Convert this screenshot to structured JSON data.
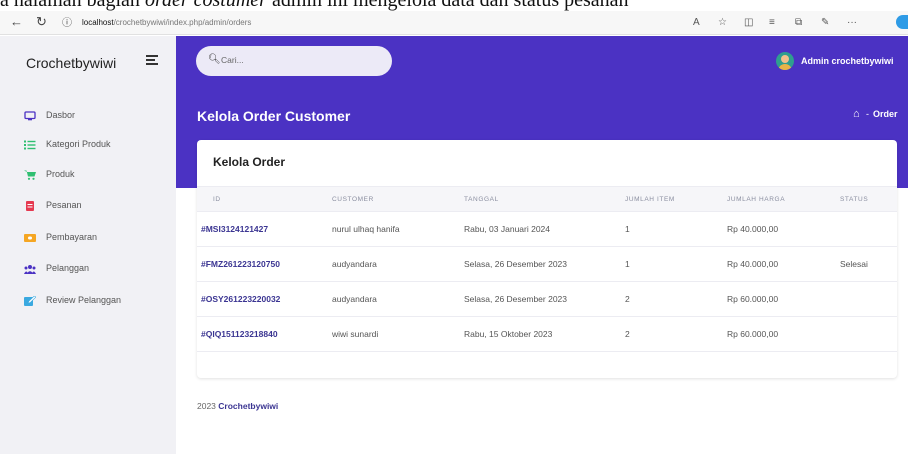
{
  "caption": {
    "prefix": "a halaman bagian ",
    "italic": "order costumer",
    "suffix": " admin ini mengelola data dan status pesanan"
  },
  "browser": {
    "url_host": "localhost",
    "url_path": "/crochetbywiwi/index.php/admin/orders"
  },
  "sidebar": {
    "brand": "Crochetbywiwi",
    "items": [
      {
        "label": "Dasbor",
        "icon": "monitor-icon",
        "color": "#4b32c3"
      },
      {
        "label": "Kategori Produk",
        "icon": "list-icon",
        "color": "#2fbf71"
      },
      {
        "label": "Produk",
        "icon": "cart-icon",
        "color": "#2fbf71"
      },
      {
        "label": "Pesanan",
        "icon": "document-icon",
        "color": "#e53950"
      },
      {
        "label": "Pembayaran",
        "icon": "card-icon",
        "color": "#f5a623"
      },
      {
        "label": "Pelanggan",
        "icon": "users-icon",
        "color": "#4b32c3"
      },
      {
        "label": "Review Pelanggan",
        "icon": "edit-icon",
        "color": "#3aa9e0"
      }
    ]
  },
  "header": {
    "search_placeholder": "Cari...",
    "admin_name": "Admin crochetbywiwi",
    "page_title": "Kelola Order Customer",
    "breadcrumb_sep": "-",
    "breadcrumb_current": "Order",
    "accent": "#4b32c3"
  },
  "card": {
    "title": "Kelola Order",
    "columns": [
      "ID",
      "CUSTOMER",
      "TANGGAL",
      "JUMLAH ITEM",
      "JUMLAH HARGA",
      "STATUS"
    ],
    "rows": [
      {
        "id": "#MSI3124121427",
        "customer": "nurul ulhaq hanifa",
        "date": "Rabu, 03 Januari 2024",
        "items": "1",
        "price": "Rp 40.000,00",
        "status": ""
      },
      {
        "id": "#FMZ261223120750",
        "customer": "audyandara",
        "date": "Selasa, 26 Desember 2023",
        "items": "1",
        "price": "Rp 40.000,00",
        "status": "Selesai"
      },
      {
        "id": "#OSY261223220032",
        "customer": "audyandara",
        "date": "Selasa, 26 Desember 2023",
        "items": "2",
        "price": "Rp 60.000,00",
        "status": ""
      },
      {
        "id": "#QIQ151123218840",
        "customer": "wiwi sunardi",
        "date": "Rabu, 15 Oktober 2023",
        "items": "2",
        "price": "Rp 60.000,00",
        "status": ""
      }
    ]
  },
  "footer": {
    "year": "2023",
    "brand": "Crochetbywiwi"
  }
}
